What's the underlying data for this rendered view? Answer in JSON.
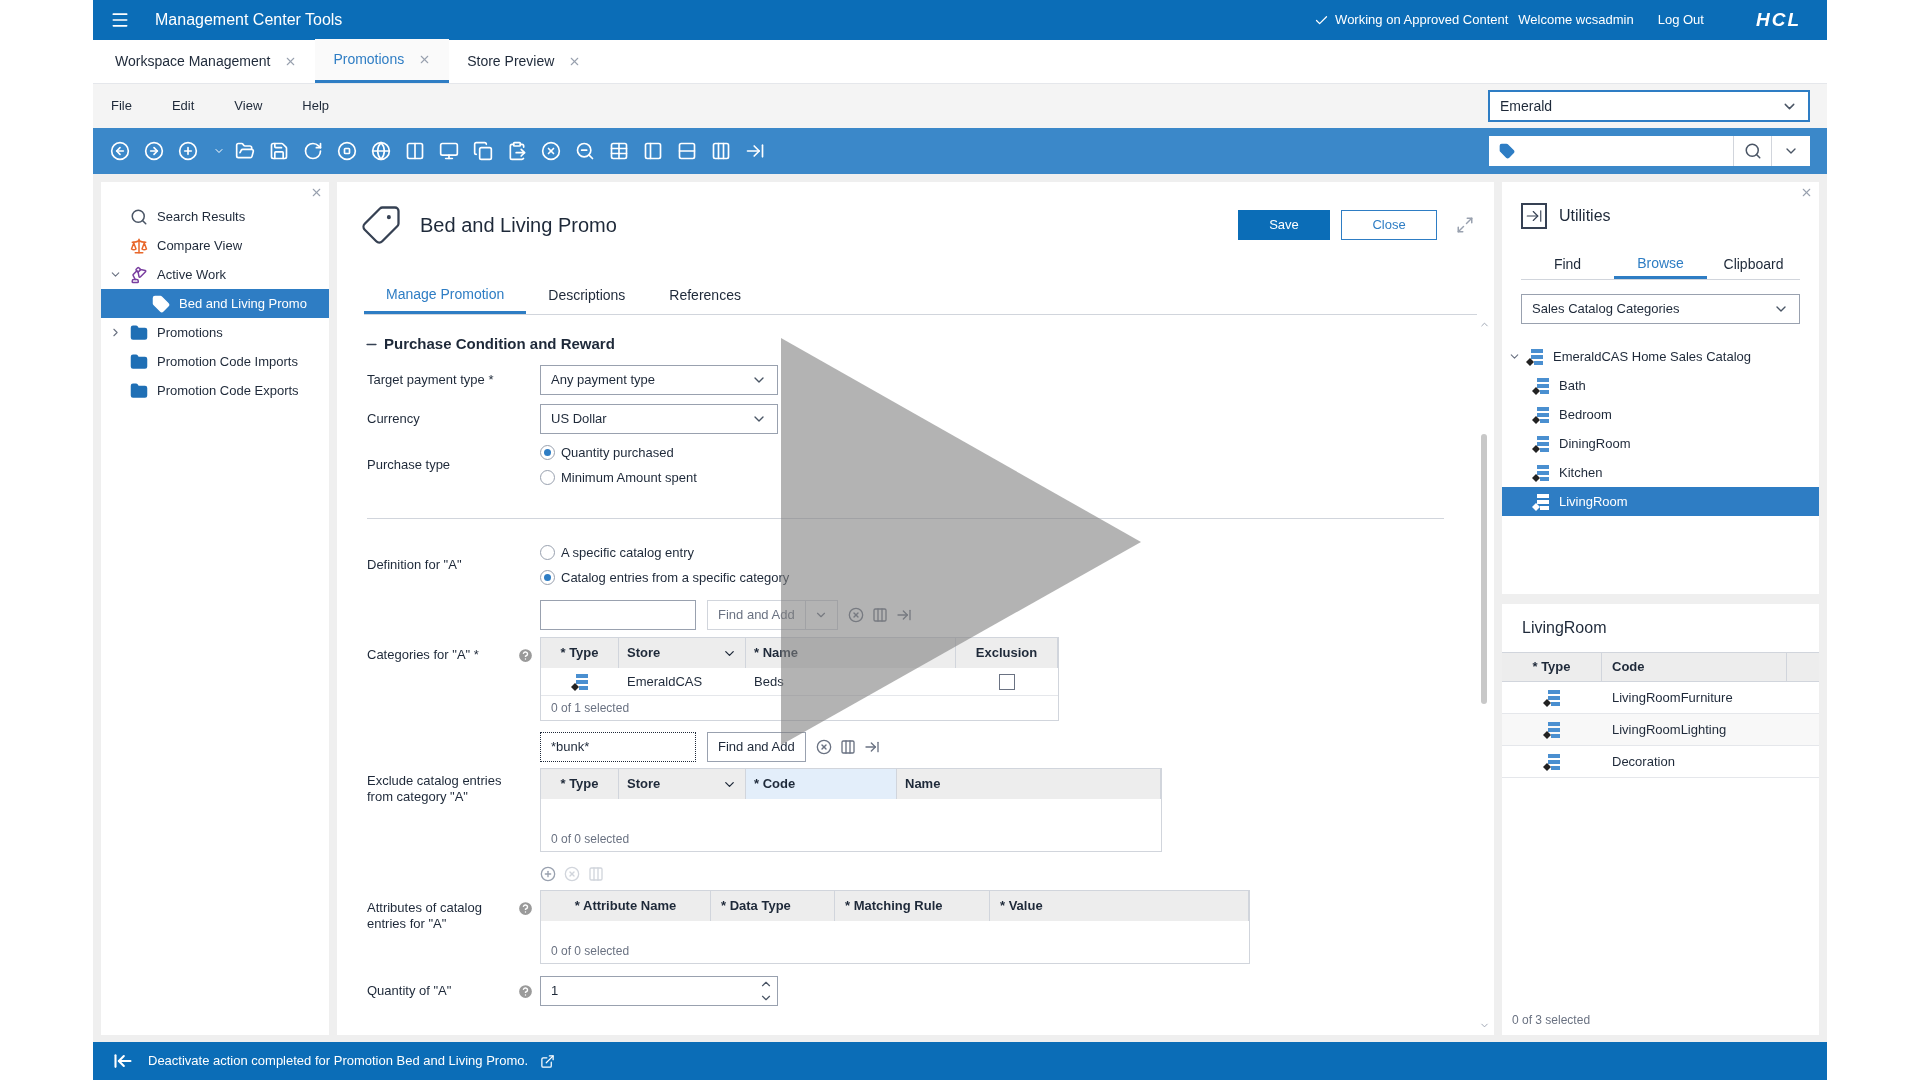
{
  "header": {
    "title": "Management Center Tools",
    "status": "Working on Approved Content",
    "welcome": "Welcome wcsadmin",
    "logout": "Log Out",
    "logo": "HCL"
  },
  "tabs": [
    {
      "label": "Workspace Management",
      "selected": false
    },
    {
      "label": "Promotions",
      "selected": true
    },
    {
      "label": "Store Preview",
      "selected": false
    }
  ],
  "menu": [
    "File",
    "Edit",
    "View",
    "Help"
  ],
  "store_select": {
    "value": "Emerald"
  },
  "sidebar": {
    "items": [
      {
        "label": "Search Results",
        "kind": "search",
        "selected": false
      },
      {
        "label": "Compare View",
        "kind": "compare",
        "selected": false
      },
      {
        "label": "Active Work",
        "kind": "work",
        "selected": false,
        "expanded": true,
        "children": [
          {
            "label": "Bed and Living Promo",
            "kind": "promo",
            "selected": true
          }
        ]
      },
      {
        "label": "Promotions",
        "kind": "folder",
        "selected": false,
        "expanded": false
      },
      {
        "label": "Promotion Code Imports",
        "kind": "folder",
        "selected": false
      },
      {
        "label": "Promotion Code Exports",
        "kind": "folder",
        "selected": false
      }
    ]
  },
  "editor": {
    "title": "Bed and Living Promo",
    "save": "Save",
    "close": "Close",
    "tabs": [
      {
        "label": "Manage Promotion",
        "selected": true
      },
      {
        "label": "Descriptions",
        "selected": false
      },
      {
        "label": "References",
        "selected": false
      }
    ],
    "section": {
      "title": "Purchase Condition and Reward",
      "expanded": true
    },
    "target_payment": {
      "label": "Target payment type *",
      "value": "Any payment type"
    },
    "currency": {
      "label": "Currency",
      "value": "US Dollar"
    },
    "purchase_type": {
      "label": "Purchase type",
      "options": [
        {
          "label": "Quantity purchased",
          "selected": true
        },
        {
          "label": "Minimum Amount spent",
          "selected": false
        }
      ]
    },
    "definition": {
      "label": "Definition for \"A\"",
      "options": [
        {
          "label": "A specific catalog entry",
          "selected": false
        },
        {
          "label": "Catalog entries from a specific category",
          "selected": true
        }
      ]
    },
    "categories": {
      "label": "Categories for \"A\" *",
      "find": {
        "label": "Find and Add",
        "disabled": true
      },
      "columns": [
        "* Type",
        "Store",
        "* Name",
        "Exclusion"
      ],
      "rows": [
        {
          "store": "EmeraldCAS",
          "name": "Beds",
          "exclusion": false
        }
      ],
      "footer": "0 of 1 selected"
    },
    "exclude": {
      "label": "Exclude catalog entries from category \"A\"",
      "search": "*bunk*",
      "find": {
        "label": "Find and Add",
        "disabled": false
      },
      "columns": [
        {
          "label": "* Type",
          "selected": false
        },
        {
          "label": "Store",
          "selected": false
        },
        {
          "label": "* Code",
          "selected": true
        },
        {
          "label": "Name",
          "selected": false
        }
      ],
      "footer": "0 of 0 selected"
    },
    "attributes": {
      "label": "Attributes of catalog entries for \"A\"",
      "columns": [
        "* Attribute Name",
        "* Data Type",
        "* Matching Rule",
        "* Value"
      ],
      "footer": "0 of 0 selected"
    },
    "quantity": {
      "label": "Quantity of \"A\"",
      "value": "1"
    }
  },
  "utilities": {
    "title": "Utilities",
    "tabs": [
      {
        "label": "Find",
        "selected": false
      },
      {
        "label": "Browse",
        "selected": true
      },
      {
        "label": "Clipboard",
        "selected": false
      }
    ],
    "select": "Sales Catalog Categories",
    "tree": [
      {
        "label": "EmeraldCAS Home Sales Catalog",
        "selected": false,
        "expanded": true,
        "children": [
          {
            "label": "Bath",
            "selected": false
          },
          {
            "label": "Bedroom",
            "selected": false
          },
          {
            "label": "DiningRoom",
            "selected": false
          },
          {
            "label": "Kitchen",
            "selected": false
          },
          {
            "label": "LivingRoom",
            "selected": true
          }
        ]
      }
    ],
    "detail": {
      "title": "LivingRoom",
      "columns": [
        "* Type",
        "Code"
      ],
      "rows": [
        "LivingRoomFurniture",
        "LivingRoomLighting",
        "Decoration"
      ],
      "footer": "0 of 3 selected"
    }
  },
  "status_bar": {
    "message": "Deactivate action completed for Promotion Bed and Living Promo."
  }
}
